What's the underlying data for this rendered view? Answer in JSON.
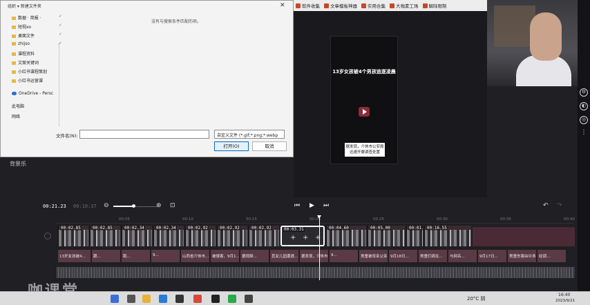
{
  "dialog": {
    "organize_label": "组织 ▾   新建文件夹",
    "nav_items": [
      {
        "label": "数据 · 简报 ·",
        "pinned": true
      },
      {
        "label": "短视xo",
        "pinned": true
      },
      {
        "label": "桌面文件",
        "pinned": true
      },
      {
        "label": "zhijso",
        "pinned": true
      },
      {
        "label": "课程资料",
        "pinned": false
      },
      {
        "label": "文案关键词",
        "pinned": false
      },
      {
        "label": "小红书课程策划",
        "pinned": false
      },
      {
        "label": "小红书运营课",
        "pinned": false
      }
    ],
    "onedrive_label": "OneDrive - Persc",
    "this_pc_label": "此电脑",
    "network_label": "网络",
    "empty_message": "没有与搜索条件匹配的项。",
    "filename_label": "文件名(N):",
    "filename_value": "",
    "filter_value": "自定义文件 (*.gif;*.png;*.webp",
    "open_button": "打开(O)",
    "cancel_button": "取消",
    "close_glyph": "✕"
  },
  "bookmarks": [
    {
      "label": "软件收集"
    },
    {
      "label": "文章模板神器"
    },
    {
      "label": "实用合集"
    },
    {
      "label": "大咖素工场"
    },
    {
      "label": "解除限制"
    }
  ],
  "preview": {
    "headline": "13岁女孩被4个男孩追逐凌晨",
    "caption": "据发现，介休市公安局迅速开展调查处置"
  },
  "left_panel": {
    "bgm_label": "背景乐"
  },
  "transport": {
    "current_time": "00:21.23",
    "total_time": "00:10:37",
    "zoom_level": 0.45
  },
  "ruler_marks": [
    "00:05",
    "00:10",
    "00:15",
    "00:20",
    "00:25",
    "00:30",
    "00:35",
    "00:40"
  ],
  "video_clips": [
    {
      "duration": "00:02.85",
      "selected": false
    },
    {
      "duration": "00:02.85",
      "selected": false
    },
    {
      "duration": "00:02.34",
      "selected": false
    },
    {
      "duration": "00:02.34",
      "selected": false
    },
    {
      "duration": "00:02.92",
      "selected": false
    },
    {
      "duration": "00:02.92",
      "selected": false
    },
    {
      "duration": "00:02.92",
      "selected": false
    },
    {
      "duration": "00:03.31",
      "selected": true
    },
    {
      "duration": "00:04.60",
      "selected": false
    },
    {
      "duration": "00:05.00",
      "selected": false
    },
    {
      "duration": "00:01.",
      "selected": false
    },
    {
      "duration": "00:16.55",
      "selected": false
    }
  ],
  "text_clips": [
    "13岁女孩被4...",
    "跟...",
    "跑...",
    "9...",
    "山西省介休市...",
    "被侵害，9月1...",
    "据视频...",
    "其女儿因遭遇...",
    "据发现，介休市公...",
    "9...",
    "男童被母亲父亲...",
    "9月18日...",
    "男童们病在...",
    "与网名...",
    "9月17日...",
    "男童伤害由许多检察...",
    "经调..."
  ],
  "taskbar": {
    "weather": "20°C 阴",
    "time": "16:40",
    "date": "2023/9/21"
  },
  "watermark": "咖课堂",
  "colors": {
    "accent": "#0067c0",
    "clip": "#3b2a30",
    "text_clip": "#5a3a44"
  }
}
